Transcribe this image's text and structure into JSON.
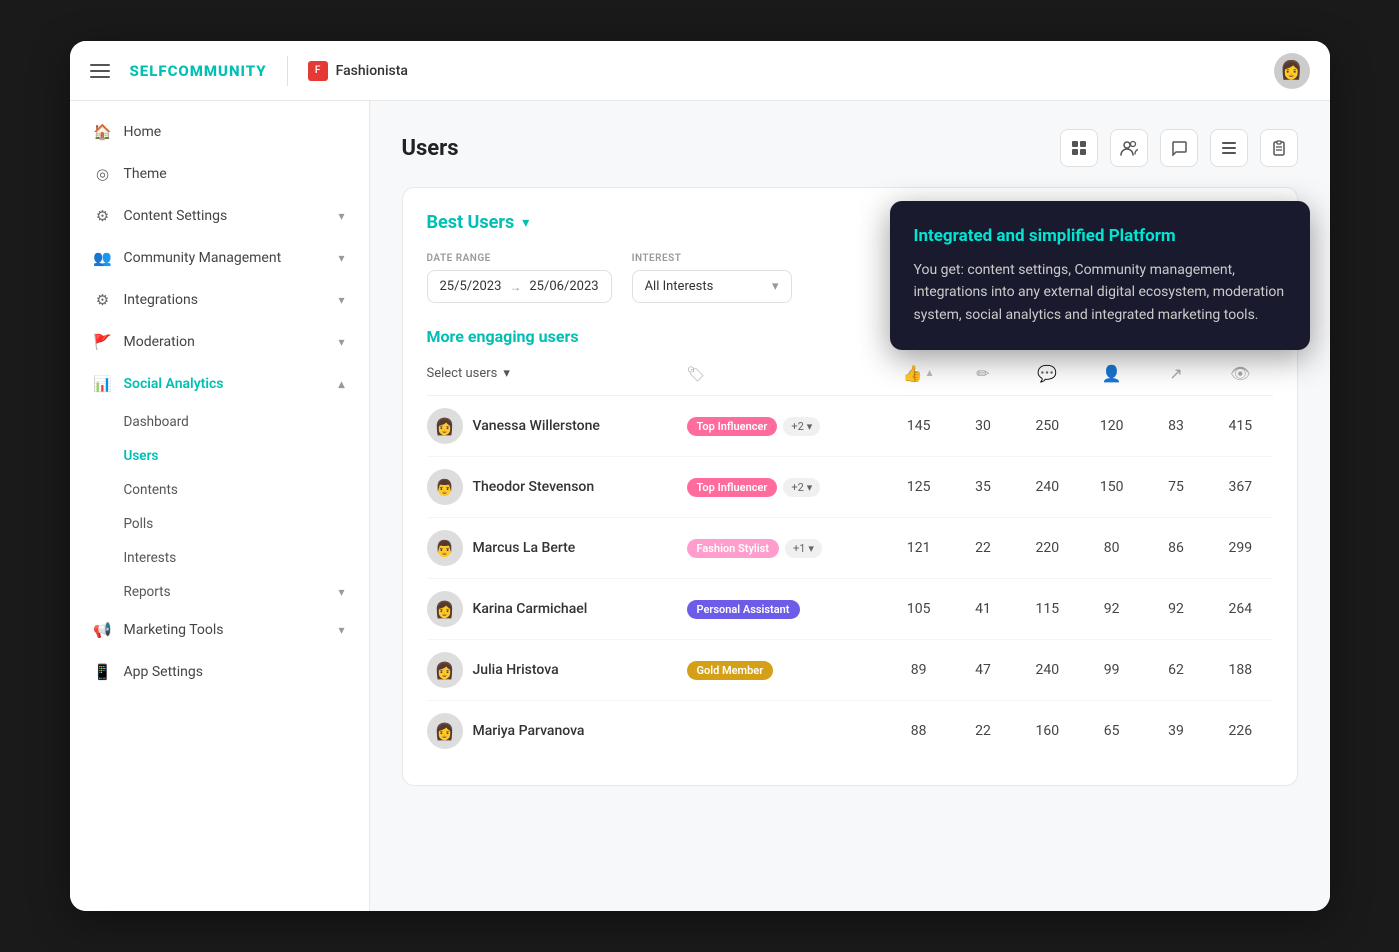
{
  "topbar": {
    "logo": "SELFCOMMUNITY",
    "community_name": "Fashionista",
    "hamburger_label": "menu"
  },
  "sidebar": {
    "items": [
      {
        "id": "home",
        "label": "Home",
        "icon": "🏠",
        "active": false,
        "expandable": false
      },
      {
        "id": "theme",
        "label": "Theme",
        "icon": "🎨",
        "active": false,
        "expandable": false
      },
      {
        "id": "content-settings",
        "label": "Content Settings",
        "icon": "⚙",
        "active": false,
        "expandable": true
      },
      {
        "id": "community-management",
        "label": "Community Management",
        "icon": "👥",
        "active": false,
        "expandable": true
      },
      {
        "id": "integrations",
        "label": "Integrations",
        "icon": "⚙",
        "active": false,
        "expandable": true
      },
      {
        "id": "moderation",
        "label": "Moderation",
        "icon": "🚩",
        "active": false,
        "expandable": true
      },
      {
        "id": "social-analytics",
        "label": "Social Analytics",
        "icon": "📊",
        "active": true,
        "expandable": true
      }
    ],
    "social_analytics_sub": [
      {
        "id": "dashboard",
        "label": "Dashboard",
        "active": false
      },
      {
        "id": "users",
        "label": "Users",
        "active": true
      },
      {
        "id": "contents",
        "label": "Contents",
        "active": false
      },
      {
        "id": "polls",
        "label": "Polls",
        "active": false
      },
      {
        "id": "interests",
        "label": "Interests",
        "active": false
      },
      {
        "id": "reports",
        "label": "Reports",
        "active": false,
        "expandable": true
      }
    ],
    "bottom_items": [
      {
        "id": "marketing-tools",
        "label": "Marketing Tools",
        "icon": "📢",
        "expandable": true
      },
      {
        "id": "app-settings",
        "label": "App Settings",
        "icon": "📱",
        "expandable": false
      }
    ]
  },
  "page": {
    "title": "Users",
    "header_icons": [
      "grid-icon",
      "users-icon",
      "chat-icon",
      "list-icon",
      "clipboard-icon"
    ]
  },
  "card": {
    "title": "Best Users",
    "filters": {
      "date_range_label": "DATE RANGE",
      "date_from": "25/5/2023",
      "date_to": "25/06/2023",
      "interest_label": "INTEREST",
      "interest_value": "All Interests"
    },
    "section_title": "More engaging users",
    "select_users_label": "Select users",
    "columns": {
      "likes": "👍",
      "upvotes": "▲",
      "edit": "✏",
      "comments": "💬",
      "follow": "👤",
      "share": "↗",
      "views": "👁"
    },
    "rows": [
      {
        "id": 1,
        "name": "Vanessa Willerstone",
        "badge": "Top Influencer",
        "badge_type": "top-influencer",
        "plus": "+2",
        "likes": 145,
        "upvotes": 30,
        "comments": 250,
        "follow": 120,
        "share": 83,
        "views": 415,
        "avatar": "👩"
      },
      {
        "id": 2,
        "name": "Theodor Stevenson",
        "badge": "Top Influencer",
        "badge_type": "top-influencer",
        "plus": "+2",
        "likes": 125,
        "upvotes": 35,
        "comments": 240,
        "follow": 150,
        "share": 75,
        "views": 367,
        "avatar": "👨"
      },
      {
        "id": 3,
        "name": "Marcus La Berte",
        "badge": "Fashion Stylist",
        "badge_type": "fashion-stylist",
        "plus": "+1",
        "likes": 121,
        "upvotes": 22,
        "comments": 220,
        "follow": 80,
        "share": 86,
        "views": 299,
        "avatar": "👨"
      },
      {
        "id": 4,
        "name": "Karina Carmichael",
        "badge": "Personal Assistant",
        "badge_type": "personal-assistant",
        "plus": null,
        "likes": 105,
        "upvotes": 41,
        "comments": 115,
        "follow": 92,
        "share": 92,
        "views": 264,
        "avatar": "👩"
      },
      {
        "id": 5,
        "name": "Julia Hristova",
        "badge": "Gold Member",
        "badge_type": "gold-member",
        "plus": null,
        "likes": 89,
        "upvotes": 47,
        "comments": 240,
        "follow": 99,
        "share": 62,
        "views": 188,
        "avatar": "👩"
      },
      {
        "id": 6,
        "name": "Mariya Parvanova",
        "badge": null,
        "badge_type": null,
        "plus": null,
        "likes": 88,
        "upvotes": 22,
        "comments": 160,
        "follow": 65,
        "share": 39,
        "views": 226,
        "avatar": "👩"
      }
    ]
  },
  "tooltip": {
    "title": "Integrated and simplified Platform",
    "body": "You get: content settings, Community management, integrations into any external digital ecosystem, moderation system, social analytics and integrated marketing tools."
  }
}
